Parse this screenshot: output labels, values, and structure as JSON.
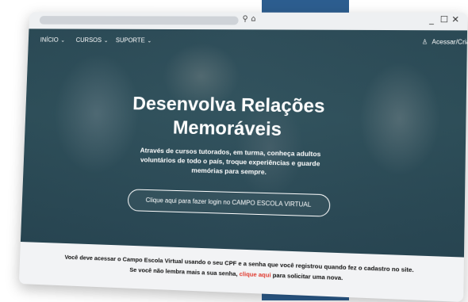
{
  "browser": {
    "search_icon": "⚲",
    "home_icon": "⌂",
    "minimize": "_",
    "maximize": "☐",
    "close": "✕"
  },
  "nav": {
    "items": [
      {
        "label": "INÍCIO",
        "chevron": "⌄"
      },
      {
        "label": "CURSOS",
        "chevron": "⌄"
      },
      {
        "label": "SUPORTE",
        "chevron": "⌄"
      }
    ],
    "account_icon": "♙",
    "account_label": "Acessar/Criar"
  },
  "hero": {
    "headline_line1": "Desenvolva Relações",
    "headline_line2": "Memoráveis",
    "subtext_line1": "Através de cursos tutorados, em turma, conheça adultos",
    "subtext_line2": "voluntários de todo o país, troque experiências e guarde",
    "subtext_line3": "memórias para sempre.",
    "login_button": "Clique aqui para fazer login no CAMPO ESCOLA VIRTUAL"
  },
  "notice": {
    "line1": "Você deve acessar o Campo Escola Virtual usando o seu CPF e a senha que você registrou quando fez o cadastro no site.",
    "line2_before": "Se você não lembra mais a sua senha,",
    "line2_link": "clique aqui",
    "line2_after": "para solicitar uma nova."
  },
  "colors": {
    "accent_blue": "#2c5d8f",
    "link_red": "#e03a2f"
  }
}
